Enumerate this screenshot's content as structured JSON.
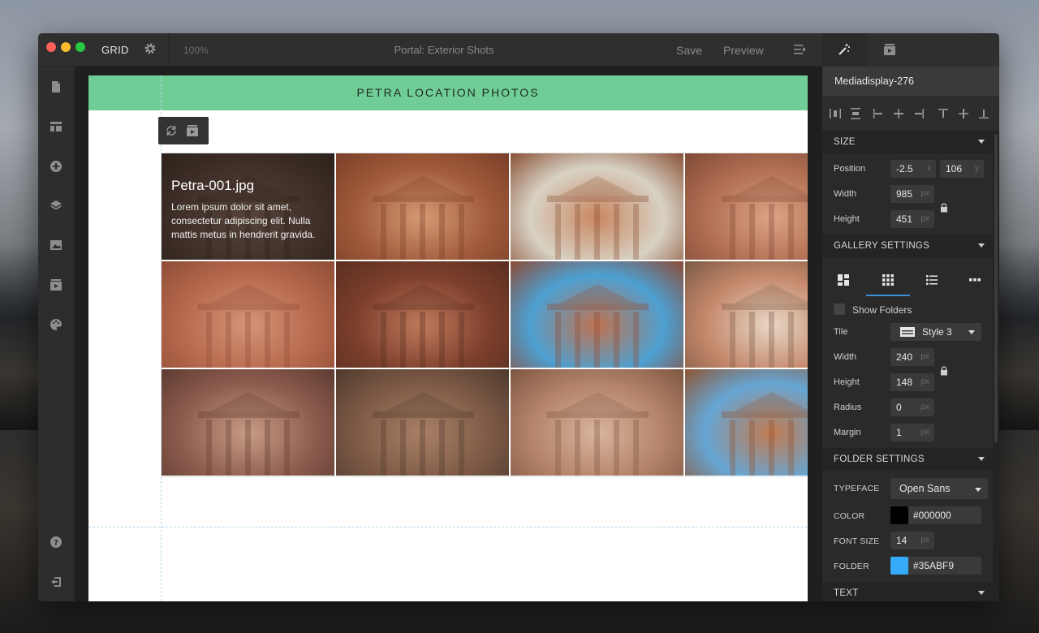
{
  "titlebar": {
    "app_name": "GRID",
    "zoom": "100%",
    "document_title": "Portal: Exterior Shots",
    "save_label": "Save",
    "preview_label": "Preview"
  },
  "left_sidebar": {
    "icons": [
      "page-icon",
      "layout-icon",
      "add-icon",
      "layers-icon",
      "image-icon",
      "media-icon",
      "palette-icon",
      "help-icon",
      "logout-icon"
    ]
  },
  "canvas": {
    "banner_title": "PETRA LOCATION PHOTOS",
    "banner_color": "#6fcd95",
    "gallery": {
      "tiles": [
        {
          "name": "Petra-001.jpg",
          "caption": "Lorem ipsum dolor sit amet, consectetur adipiscing elit. Nulla mattis metus in hendrerit gravida.",
          "colors": [
            "#6b5145",
            "#9b7b68",
            "#3f3026"
          ]
        },
        {
          "colors": [
            "#a15a3a",
            "#d49a74",
            "#7a3f28"
          ]
        },
        {
          "colors": [
            "#d8d2c4",
            "#c98760",
            "#8a5036"
          ]
        },
        {
          "colors": [
            "#b06e52",
            "#dda386",
            "#7e4a35"
          ]
        },
        {
          "colors": [
            "#b7694d",
            "#d49478",
            "#8e4d36"
          ]
        },
        {
          "colors": [
            "#7c3f2c",
            "#c07a5c",
            "#5a2e20"
          ]
        },
        {
          "colors": [
            "#4da0d2",
            "#c07350",
            "#8e4a34"
          ]
        },
        {
          "colors": [
            "#c4876a",
            "#e8d8c6",
            "#7b5a45"
          ]
        },
        {
          "colors": [
            "#8d5c4e",
            "#c89c86",
            "#5e3b31"
          ]
        },
        {
          "colors": [
            "#7e5a46",
            "#a98066",
            "#4f3a2d"
          ]
        },
        {
          "colors": [
            "#b3836a",
            "#d9b49c",
            "#7e5642"
          ]
        },
        {
          "colors": [
            "#66a6d4",
            "#c17a50",
            "#8f5432"
          ]
        }
      ]
    }
  },
  "panel": {
    "element_name": "Mediadisplay-276",
    "size": {
      "header": "SIZE",
      "position_label": "Position",
      "position_x": "-2.5",
      "position_x_unit": "x",
      "position_y": "106",
      "position_y_unit": "y",
      "width_label": "Width",
      "width": "985",
      "width_unit": "px",
      "height_label": "Height",
      "height": "451",
      "height_unit": "px"
    },
    "gallery_settings": {
      "header": "GALLERY SETTINGS",
      "show_folders_label": "Show Folders",
      "tile_label": "Tile",
      "tile_style": "Style 3",
      "width_label": "Width",
      "width": "240",
      "width_unit": "px",
      "height_label": "Height",
      "height": "148",
      "height_unit": "px",
      "radius_label": "Radius",
      "radius": "0",
      "radius_unit": "px",
      "margin_label": "Margin",
      "margin": "1",
      "margin_unit": "px"
    },
    "folder_settings": {
      "header": "FOLDER SETTINGS",
      "typeface_label": "TYPEFACE",
      "typeface": "Open Sans",
      "color_label": "COLOR",
      "color": "#000000",
      "font_size_label": "FONT SIZE",
      "font_size": "14",
      "font_size_unit": "px",
      "folder_label": "FOLDER",
      "folder_color": "#35ABF9"
    },
    "text_header": "TEXT"
  }
}
